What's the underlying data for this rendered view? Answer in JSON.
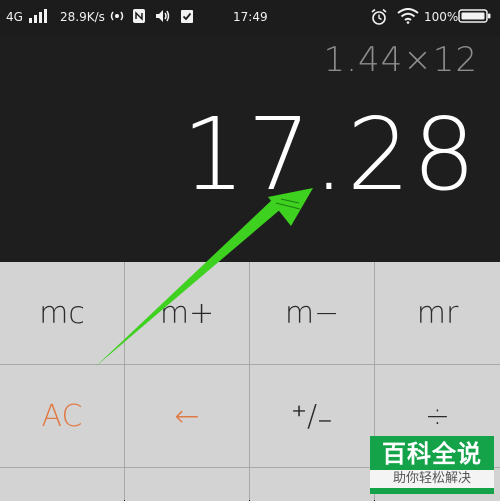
{
  "status_bar": {
    "network": "4G",
    "speed": "28.9K/s",
    "time": "17:49",
    "battery": "100%",
    "icons": [
      "signal-icon",
      "hotspot-icon",
      "nfc-icon",
      "volume-icon",
      "check-icon",
      "alarm-icon",
      "wifi-icon",
      "battery-icon"
    ]
  },
  "display": {
    "expression": "1.44×12",
    "result": "17.28"
  },
  "keypad": {
    "mc": "mc",
    "m_plus": "m+",
    "m_minus": "m−",
    "mr": "mr",
    "ac": "AC",
    "backspace": "←",
    "plus_minus": "⁺∕₋",
    "divide": "÷"
  },
  "colors": {
    "accent_orange": "#e07a45",
    "arrow_green": "#3ed11f",
    "watermark_green": "#15a34a"
  },
  "watermark": {
    "title": "百科全说",
    "subtitle": "助你轻松解决"
  }
}
